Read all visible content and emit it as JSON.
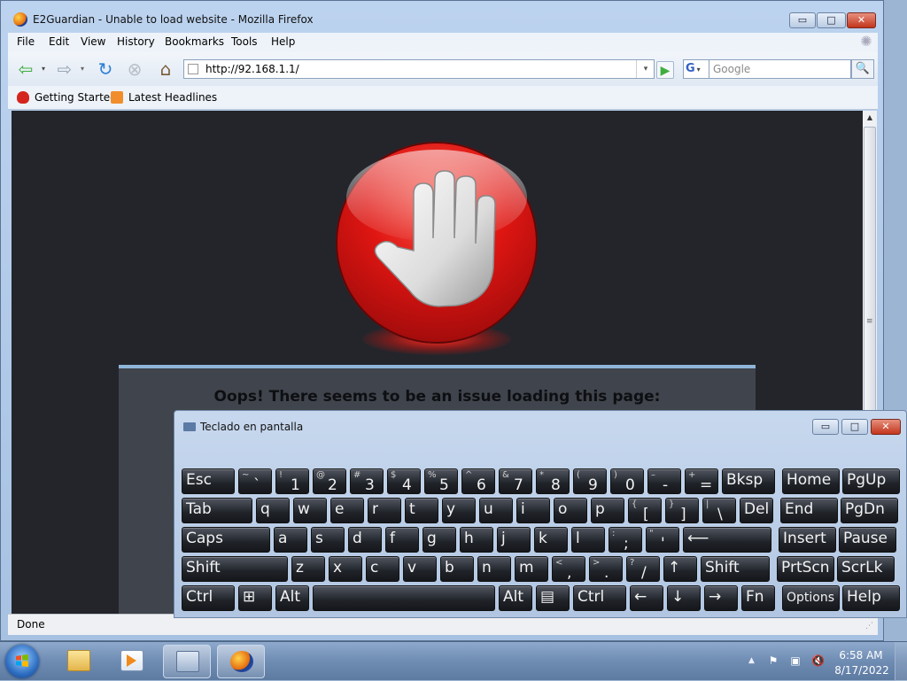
{
  "window": {
    "title": "E2Guardian - Unable to load website - Mozilla Firefox",
    "min_icon": "minimize-icon",
    "max_icon": "maximize-icon",
    "close_icon": "close-icon",
    "min_glyph": "▭",
    "max_glyph": "□",
    "close_glyph": "✕"
  },
  "menu": [
    "File",
    "Edit",
    "View",
    "History",
    "Bookmarks",
    "Tools",
    "Help"
  ],
  "nav": {
    "back_glyph": "⇦",
    "forward_glyph": "⇨",
    "reload_glyph": "↻",
    "stop_glyph": "⊗",
    "home_glyph": "⌂",
    "drop_glyph": "▾",
    "go_glyph": "▶",
    "url": "http://92.168.1.1/",
    "search_engine_label": "G",
    "search_placeholder": "Google",
    "search_glyph": "🔍"
  },
  "bookmarks": [
    {
      "label": "Getting Started",
      "icon": "getting-started-icon"
    },
    {
      "label": "Latest Headlines",
      "icon": "rss-icon"
    }
  ],
  "page": {
    "error_message": "Oops! There seems to be an issue loading this page:",
    "icon": "stop-hand-icon"
  },
  "status": {
    "text": "Done"
  },
  "osk": {
    "title": "Teclado en pantalla",
    "rows": [
      [
        {
          "label": "Esc"
        },
        {
          "shift": "~",
          "label": "`"
        },
        {
          "shift": "!",
          "label": "1"
        },
        {
          "shift": "@",
          "label": "2"
        },
        {
          "shift": "#",
          "label": "3"
        },
        {
          "shift": "$",
          "label": "4"
        },
        {
          "shift": "%",
          "label": "5"
        },
        {
          "shift": "^",
          "label": "6"
        },
        {
          "shift": "&",
          "label": "7"
        },
        {
          "shift": "*",
          "label": "8"
        },
        {
          "shift": "(",
          "label": "9"
        },
        {
          "shift": ")",
          "label": "0"
        },
        {
          "shift": "–",
          "label": "-"
        },
        {
          "shift": "+",
          "label": "="
        },
        {
          "label": "Bksp"
        },
        {
          "label": "Home"
        },
        {
          "label": "PgUp"
        }
      ],
      [
        {
          "label": "Tab"
        },
        {
          "label": "q"
        },
        {
          "label": "w"
        },
        {
          "label": "e"
        },
        {
          "label": "r"
        },
        {
          "label": "t"
        },
        {
          "label": "y"
        },
        {
          "label": "u"
        },
        {
          "label": "i"
        },
        {
          "label": "o"
        },
        {
          "label": "p"
        },
        {
          "shift": "{",
          "label": "["
        },
        {
          "shift": "}",
          "label": "]"
        },
        {
          "shift": "|",
          "label": "\\"
        },
        {
          "label": "Del"
        },
        {
          "label": "End"
        },
        {
          "label": "PgDn"
        }
      ],
      [
        {
          "label": "Caps"
        },
        {
          "label": "a"
        },
        {
          "label": "s"
        },
        {
          "label": "d"
        },
        {
          "label": "f"
        },
        {
          "label": "g"
        },
        {
          "label": "h"
        },
        {
          "label": "j"
        },
        {
          "label": "k"
        },
        {
          "label": "l"
        },
        {
          "shift": ":",
          "label": ";"
        },
        {
          "shift": "\"",
          "label": "'"
        },
        {
          "label": "⟵"
        },
        {
          "label": "Insert"
        },
        {
          "label": "Pause"
        }
      ],
      [
        {
          "label": "Shift"
        },
        {
          "label": "z"
        },
        {
          "label": "x"
        },
        {
          "label": "c"
        },
        {
          "label": "v"
        },
        {
          "label": "b"
        },
        {
          "label": "n"
        },
        {
          "label": "m"
        },
        {
          "shift": "<",
          "label": ","
        },
        {
          "shift": ">",
          "label": "."
        },
        {
          "shift": "?",
          "label": "/"
        },
        {
          "label": "↑"
        },
        {
          "label": "Shift"
        },
        {
          "label": "PrtScn"
        },
        {
          "label": "ScrLk"
        }
      ],
      [
        {
          "label": "Ctrl"
        },
        {
          "label": "⊞"
        },
        {
          "label": "Alt"
        },
        {
          "label": ""
        },
        {
          "label": "Alt"
        },
        {
          "label": "▤"
        },
        {
          "label": "Ctrl"
        },
        {
          "label": "←"
        },
        {
          "label": "↓"
        },
        {
          "label": "→"
        },
        {
          "label": "Fn"
        },
        {
          "label": "Options"
        },
        {
          "label": "Help"
        }
      ]
    ]
  },
  "taskbar": {
    "items": [
      {
        "name": "windows-explorer",
        "active": false
      },
      {
        "name": "media-player",
        "active": false
      },
      {
        "name": "on-screen-keyboard",
        "active": true
      },
      {
        "name": "firefox",
        "active": true
      }
    ],
    "tray_arrow": "▲",
    "tray_icons": [
      "action-center-flag-icon",
      "network-icon",
      "volume-muted-icon"
    ],
    "tray_glyphs": [
      "⚑",
      "▣",
      "🔇"
    ],
    "time": "6:58 AM",
    "date": "8/17/2022"
  },
  "colors": {
    "page_background": "#23252b",
    "stop_red": "#e01612",
    "panel": "#40444d",
    "panel_accent": "#8fb5d9"
  }
}
